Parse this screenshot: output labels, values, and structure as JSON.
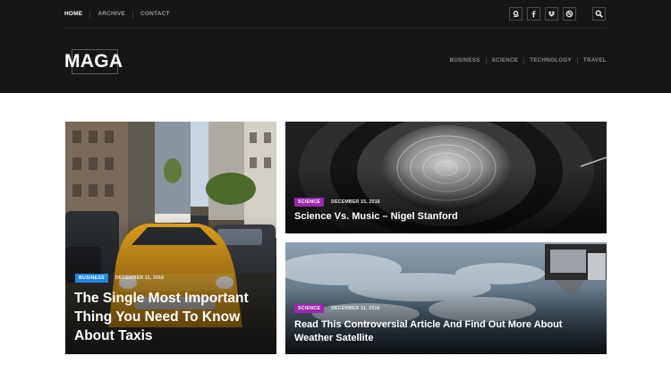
{
  "topnav": [
    {
      "label": "HOME",
      "active": true
    },
    {
      "label": "ARCHIVE",
      "active": false
    },
    {
      "label": "CONTACT",
      "active": false
    }
  ],
  "social_icons": [
    "amazon-icon",
    "facebook-icon",
    "dropbox-icon",
    "dribbble-icon"
  ],
  "search_icon": "search-icon",
  "logo": {
    "text": "MAGA"
  },
  "categories": [
    "BUSINESS",
    "SCIENCE",
    "TECHNOLOGY",
    "TRAVEL"
  ],
  "posts": [
    {
      "category": "BUSINESS",
      "category_color": "#1e88e5",
      "date": "DECEMBER 11, 2016",
      "title": "The Single Most Important Thing You Need To Know About Taxis"
    },
    {
      "category": "SCIENCE",
      "category_color": "#9c27b0",
      "date": "DECEMBER 15, 2016",
      "title": "Science Vs. Music – Nigel Stanford"
    },
    {
      "category": "SCIENCE",
      "category_color": "#9c27b0",
      "date": "DECEMBER 11, 2016",
      "title": "Read This Controversial Article And Find Out More About Weather Satellite"
    }
  ],
  "colors": {
    "header_bg": "#161616",
    "page_bg": "#ffffff"
  }
}
